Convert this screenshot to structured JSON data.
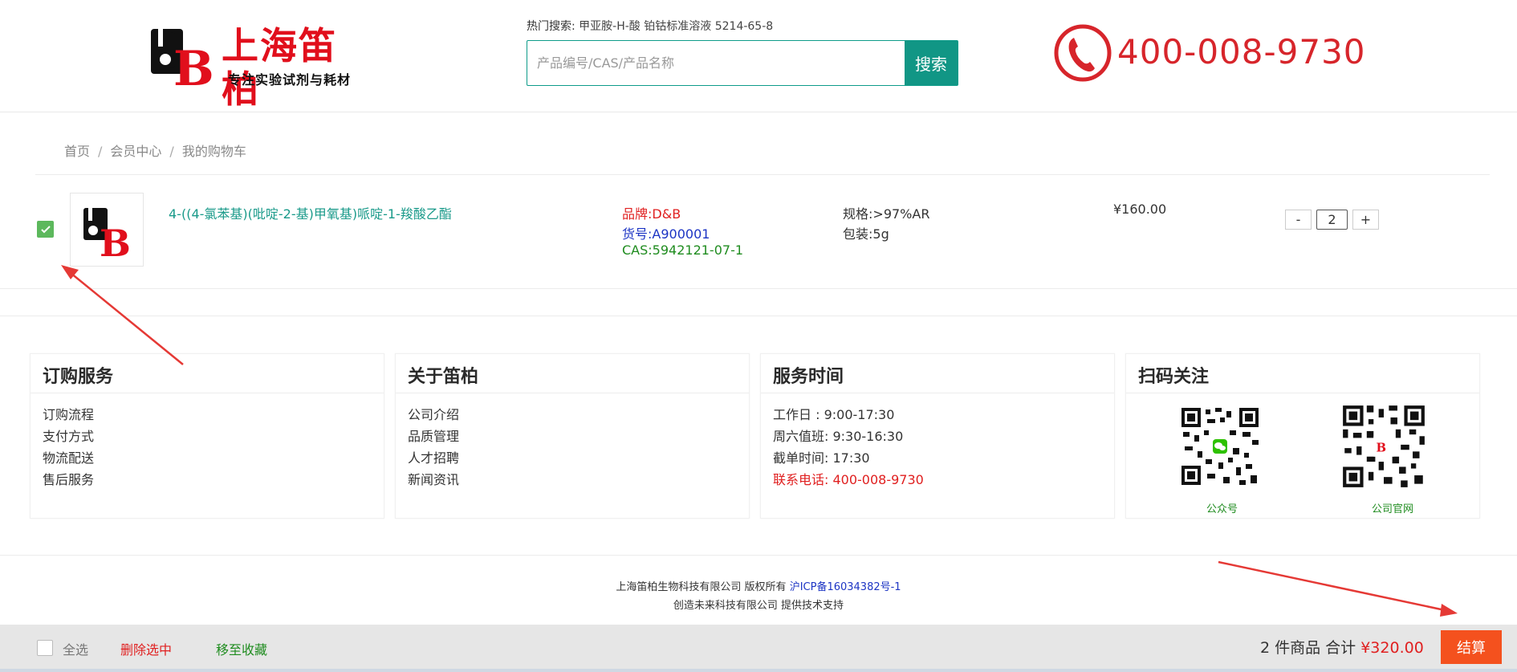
{
  "header": {
    "logo_text": "上海笛柏",
    "logo_slogan": "专注实验试剂与耗材",
    "hot_label": "热门搜索:",
    "hot_terms": [
      "甲亚胺-H-酸",
      "铂钴标准溶液",
      "5214-65-8"
    ],
    "search_placeholder": "产品编号/CAS/产品名称",
    "search_button": "搜索",
    "phone": "400-008-9730"
  },
  "breadcrumb": [
    "首页",
    "会员中心",
    "我的购物车"
  ],
  "cart_item": {
    "name": "4-((4-氯苯基)(吡啶-2-基)甲氧基)哌啶-1-羧酸乙酯",
    "brand_label": "品牌:",
    "brand": "D&B",
    "sku_label": "货号:",
    "sku": "A900001",
    "cas_label": "CAS:",
    "cas": "5942121-07-1",
    "spec_label": "规格:",
    "spec": ">97%AR",
    "pack_label": "包装:",
    "pack": "5g",
    "price": "¥160.00",
    "quantity": "2",
    "minus": "-",
    "plus": "+",
    "checked": true
  },
  "footer": {
    "col1": {
      "title": "订购服务",
      "items": [
        "订购流程",
        "支付方式",
        "物流配送",
        "售后服务"
      ]
    },
    "col2": {
      "title": "关于笛柏",
      "items": [
        "公司介绍",
        "品质管理",
        "人才招聘",
        "新闻资讯"
      ]
    },
    "col3": {
      "title": "服务时间",
      "items": [
        "工作日  : 9:00-17:30",
        "周六值班: 9:30-16:30",
        "截单时间: 17:30",
        "联系电话: 400-008-9730"
      ]
    },
    "col4": {
      "title": "扫码关注",
      "qr1_caption": "公众号",
      "qr2_caption": "公司官网"
    },
    "copyright_text": "上海笛柏生物科技有限公司 版权所有",
    "icp": "沪ICP备16034382号-1",
    "support": "创造未来科技有限公司 提供技术支持"
  },
  "bottom_bar": {
    "select_all": "全选",
    "delete_selected": "删除选中",
    "move_to_favorites": "移至收藏",
    "count_text": "2 件商品 合计",
    "total": "¥320.00",
    "checkout": "结算"
  },
  "colors": {
    "accent_teal": "#119685",
    "brand_red": "#e10f1c",
    "checkout_orange": "#f4511e",
    "annotation_red": "#e53935"
  }
}
